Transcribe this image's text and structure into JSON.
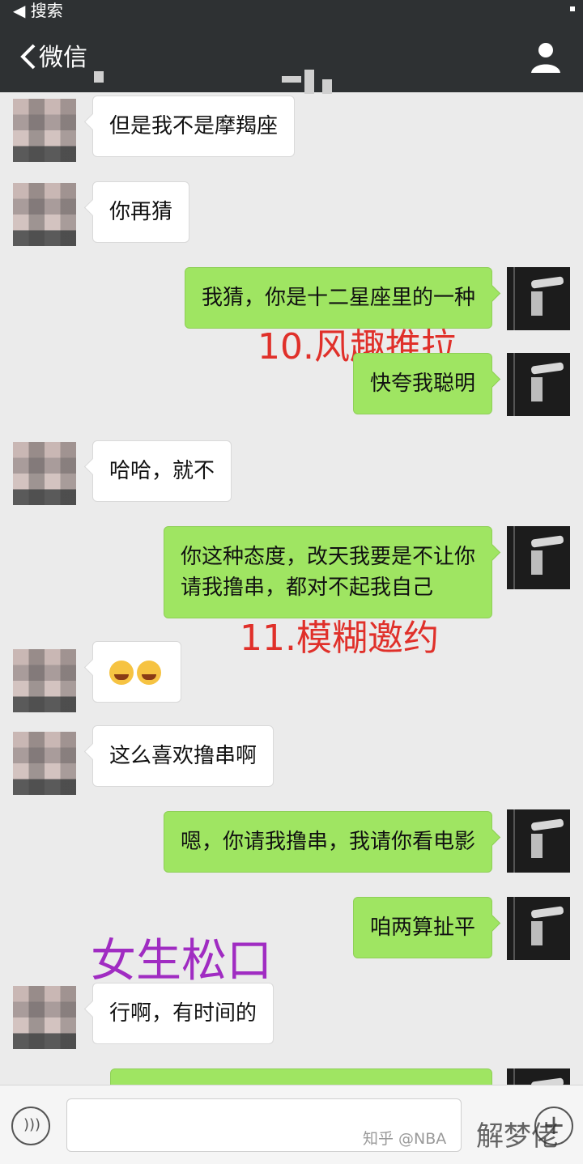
{
  "status": {
    "back_label": "◀ 搜索"
  },
  "header": {
    "back_text": "微信",
    "title": ""
  },
  "messages": [
    {
      "side": "left",
      "text": "但是我不是摩羯座"
    },
    {
      "side": "left",
      "text": "你再猜"
    },
    {
      "side": "right",
      "text": "我猜，你是十二星座里的一种"
    },
    {
      "side": "right",
      "text": "快夸我聪明"
    },
    {
      "side": "left",
      "text": "哈哈，就不"
    },
    {
      "side": "right",
      "line1": "你这种态度，改天我要是不让你",
      "line2": "请我撸串，都对不起我自己"
    },
    {
      "side": "left",
      "text": "",
      "emoji": [
        "crying-laughing",
        "crying-laughing"
      ]
    },
    {
      "side": "left",
      "text": "这么喜欢撸串啊"
    },
    {
      "side": "right",
      "text": "嗯，你请我撸串，我请你看电影"
    },
    {
      "side": "right",
      "text": "咱两算扯平"
    },
    {
      "side": "left",
      "text": "行啊，有时间的"
    }
  ],
  "annotations": {
    "a10": "10.风趣推拉",
    "a11": "11.模糊邀约",
    "girl": "女生松口"
  },
  "watermark": {
    "text": "知乎 @NBA",
    "logo": "解梦佬"
  },
  "colors": {
    "header_bg": "#2e3133",
    "sent_bubble": "#9fe562",
    "chat_bg": "#ebebeb",
    "annotation_red": "#e0302a",
    "annotation_purple": "#a02cc2"
  }
}
